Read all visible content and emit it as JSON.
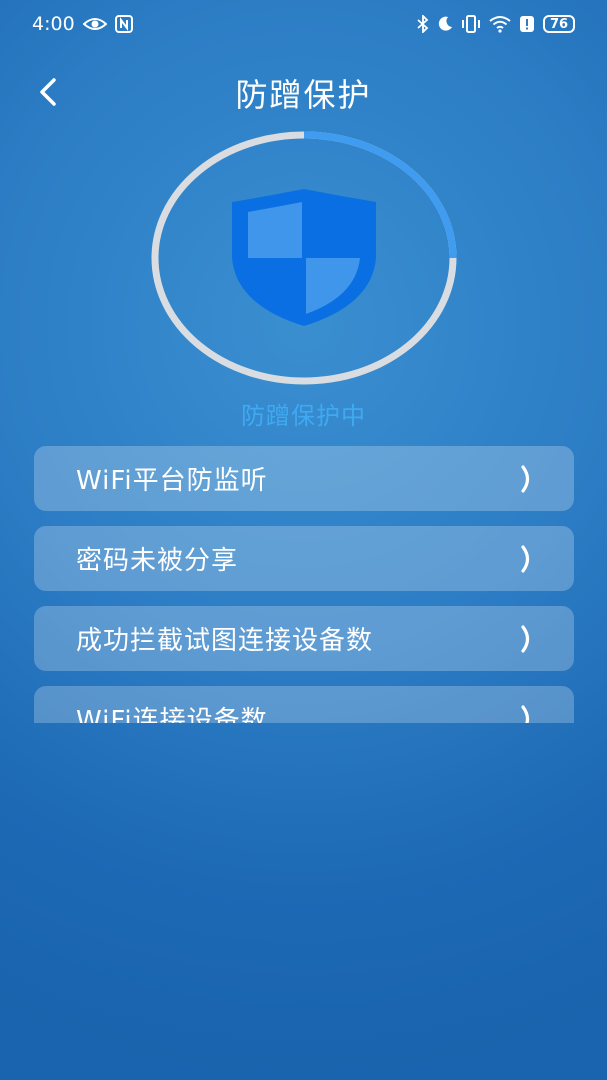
{
  "status_bar": {
    "time": "4:00",
    "battery": "76",
    "left_icons": [
      "eye-icon",
      "nfc-icon"
    ],
    "right_icons": [
      "bluetooth-icon",
      "moon-icon",
      "vibrate-icon",
      "wifi-icon",
      "alert-icon",
      "battery-icon"
    ]
  },
  "header": {
    "title": "防蹭保护",
    "back_icon": "chevron-left-icon"
  },
  "protection": {
    "status": "防蹭保护中",
    "progress": 0.2,
    "shield_icon": "shield-icon",
    "ring_track_color": "#d9dde2",
    "ring_progress_color": "#3f9cf0",
    "shield_color": "#0a6fe3"
  },
  "list": {
    "items": [
      {
        "label": "WiFi平台防监听"
      },
      {
        "label": "密码未被分享"
      },
      {
        "label": "成功拦截试图连接设备数"
      },
      {
        "label": "WiFi连接设备数"
      }
    ]
  }
}
